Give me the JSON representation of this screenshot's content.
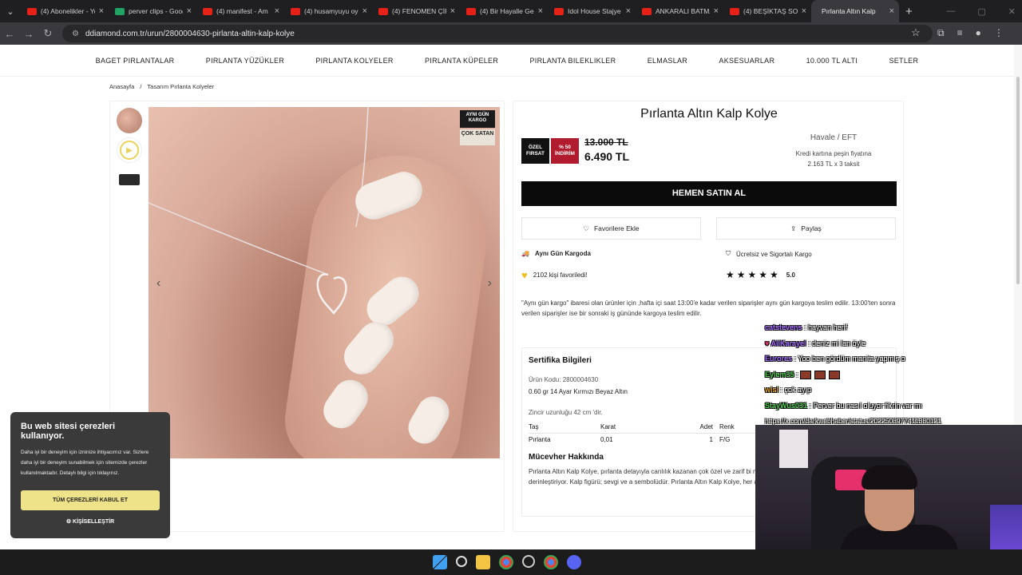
{
  "browser": {
    "tabs": [
      {
        "title": "(4) Abonelikler - YouTube",
        "icon": "youtube-icon"
      },
      {
        "title": "perver clips - Google",
        "icon": "sheets-icon"
      },
      {
        "title": "(4) manifest - Am",
        "icon": "youtube-icon"
      },
      {
        "title": "(4) husamyuyu oy",
        "icon": "youtube-icon"
      },
      {
        "title": "(4) FENOMEN ÇİF",
        "icon": "youtube-icon"
      },
      {
        "title": "(4) Bir Hayalle Ge",
        "icon": "youtube-icon"
      },
      {
        "title": "Idol House Stajye",
        "icon": "youtube-icon"
      },
      {
        "title": "ANKARALI BATMA",
        "icon": "youtube-icon"
      },
      {
        "title": "(4) BEŞİKTAŞ SOK",
        "icon": "youtube-icon"
      },
      {
        "title": "Pırlanta Altın Kalp",
        "icon": "ddiamond-icon",
        "active": true
      }
    ],
    "url": "ddiamond.com.tr/urun/2800004630-pirlanta-altin-kalp-kolye"
  },
  "site_nav": [
    "BAGET PIRLANTALAR",
    "PIRLANTA YÜZÜKLER",
    "PIRLANTA KOLYELER",
    "PIRLANTA KÜPELER",
    "PIRLANTA BILEKLIKLER",
    "ELMASLAR",
    "AKSESUARLAR",
    "10.000 TL ALTI",
    "SETLER"
  ],
  "breadcrumb": {
    "home": "Anasayfa",
    "sep": "/",
    "current": "Tasarım Pırlanta Kolyeler"
  },
  "gallery": {
    "badge_cargo": "AYNI GÜN KARGO",
    "badge_bestseller": "ÇOK SATAN",
    "prev": "‹",
    "next": "›",
    "play": "▶"
  },
  "product": {
    "title": "Pırlanta Altın Kalp Kolye",
    "badge_special": "ÖZEL FIRSAT",
    "badge_discount": "% 50 İNDİRİM",
    "old_price": "13.000 TL",
    "price": "6.490 TL",
    "payment_method": "Havale / EFT",
    "payment_note": "Kredi kartına peşin fiyatına",
    "installment": "2.163 TL x 3 taksit",
    "buy_label": "HEMEN SATIN AL",
    "fav_label": "Favorilere Ekle",
    "share_label": "Paylaş",
    "same_day": "Aynı Gün Kargoda",
    "free_cargo": "Ücretsiz ve Sigortalı Kargo",
    "fav_count": "2102 kişi favoriledi!",
    "rating": "5.0",
    "stars": "★★★★★",
    "note": "\"Aynı gün kargo\" ibaresi olan ürünler için ,hafta içi saat 13:00'e kadar verilen siparişler aynı gün kargoya teslim edilir. 13:00'ten sonra verilen siparişler ise bir sonraki iş gününde kargoya teslim edilir."
  },
  "certificate": {
    "title": "Sertifika Bilgileri",
    "code": "Ürün Kodu: 2800004630",
    "material": "0.60 gr 14 Ayar Kırmızı Beyaz Altın",
    "chain": "Zincir uzunluğu 42 cm 'dir.",
    "headers": [
      "Taş",
      "Karat",
      "Adet",
      "Renk"
    ],
    "row": [
      "Pırlanta",
      "0,01",
      "1",
      "F/G"
    ],
    "jewel_title": "Mücevher Hakkında",
    "jewel_desc": "Pırlanta Altın Kalp Kolye, pırlanta detayıyla canlılık kazanan çok özel ve zarif bi muhteşem uyumu, kalp figürü ile anlamını derinleştiriyor. Kalp figürü; sevgi ve a sembolüdür. Pırlanta Altın Kalp Kolye, her an aşkınızı hatırlatacak özel mücev"
  },
  "cookie": {
    "title": "Bu web sitesi çerezleri kullanıyor.",
    "text": "Daha iyi bir deneyim için izninize ihtiyacımız var. Sizlere daha iyi bir deneyim sunabilmek için sitemizde çerezler kullanılmaktadır. Detaylı bilgi için tıklayınız.",
    "accept": "TÜM ÇEREZLERİ KABUL ET",
    "customize": "KİŞİSELLEŞTİR"
  },
  "chat": [
    {
      "user": "catstevens",
      "color": "#a66bff",
      "msg": ": hayvan herif"
    },
    {
      "user": "AliKarayel",
      "color": "#a66bff",
      "msg": ": deniz mi lan öyle"
    },
    {
      "user": "Eurores",
      "color": "#a66bff",
      "msg": ": Yoo ben gördüm manita yapmış o"
    },
    {
      "user": "Eylem35",
      "color": "#4fd14f",
      "msg": ":"
    },
    {
      "user": "wisl",
      "color": "#e0a020",
      "msg": ": çok ayıp"
    },
    {
      "user": "StayWus031",
      "color": "#4fd14f",
      "msg": ": Perver bu nasıl oluyor fikrin var mı"
    },
    {
      "user": "",
      "color": "#fff",
      "msg": "https://x.com/darkwebhaber/status/2022508977411380121"
    }
  ],
  "colors": {
    "accent_red": "#b01c2e",
    "cookie_accept": "#efe38a",
    "buy_button": "#0b0b0b"
  }
}
